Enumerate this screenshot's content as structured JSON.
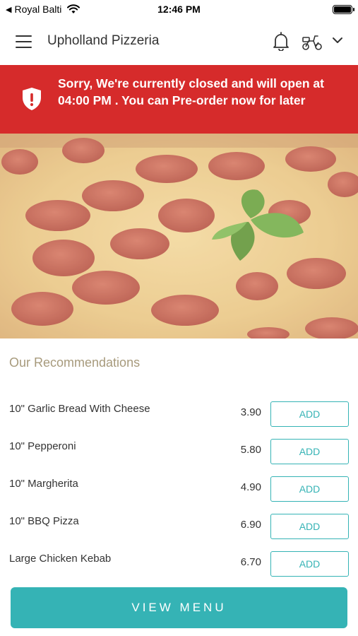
{
  "status_bar": {
    "back_arrow": "◀",
    "carrier": "Royal Balti",
    "time": "12:46 PM"
  },
  "header": {
    "title": "Upholland Pizzeria",
    "icons": [
      "menu-icon",
      "bell-icon",
      "scooter-icon",
      "chevron-down-icon"
    ]
  },
  "banner": {
    "message": "Sorry, We're currently closed and will open at 04:00 PM . You can Pre-order now for later",
    "background": "#d62b2b",
    "icon": "shield-alert-icon"
  },
  "hero": {
    "icon": "pizza-image"
  },
  "recommendations": {
    "title": "Our Recommendations",
    "items": [
      {
        "name": "10\" Garlic Bread With Cheese",
        "price": "3.90",
        "button": "ADD"
      },
      {
        "name": "10\" Pepperoni",
        "price": "5.80",
        "button": "ADD"
      },
      {
        "name": "10\" Margherita",
        "price": "4.90",
        "button": "ADD"
      },
      {
        "name": "10\" BBQ Pizza",
        "price": "6.90",
        "button": "ADD"
      },
      {
        "name": "Large Chicken Kebab",
        "price": "6.70",
        "button": "ADD"
      }
    ]
  },
  "footer": {
    "view_menu_label": "VIEW MENU",
    "accent": "#35b3b5"
  }
}
